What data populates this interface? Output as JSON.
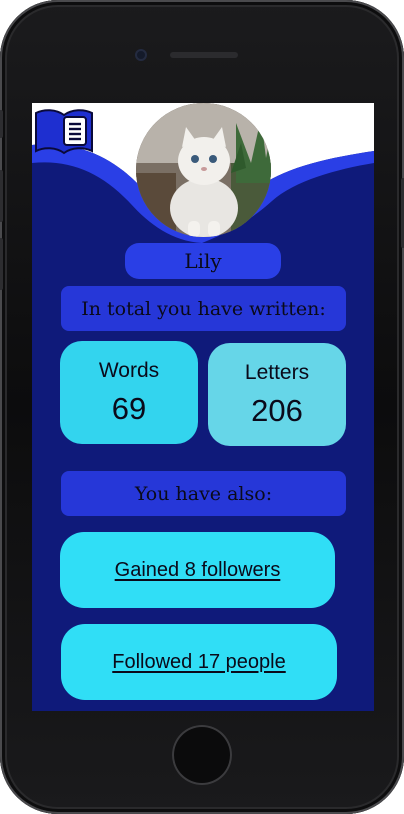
{
  "profile": {
    "name": "Lily",
    "avatar_alt": "white fluffy cat"
  },
  "stats": {
    "section_title": "In total you have written:",
    "words_label": "Words",
    "words_value": "69",
    "letters_label": "Letters",
    "letters_value": "206"
  },
  "also": {
    "section_title": "You have also:",
    "followers_link": "Gained 8 followers",
    "following_link": "Followed 17 people"
  },
  "icons": {
    "menu": "book-icon"
  },
  "colors": {
    "background": "#0f1a7a",
    "wave": "#2637d8",
    "card_primary": "#33d4ee",
    "card_secondary": "#66d6e8",
    "accent_pill": "#2a3fe6"
  }
}
